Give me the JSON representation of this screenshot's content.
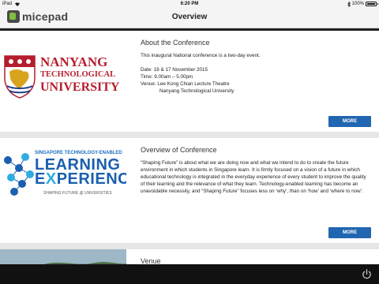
{
  "status_bar": {
    "device": "iPad",
    "time": "6:20 PM",
    "battery": "100%"
  },
  "header": {
    "logo_text": "micepad",
    "title": "Overview"
  },
  "cards": [
    {
      "image_label": "Nanyang Technological University logo",
      "title": "About the Conference",
      "intro": "This inaugural National conference is a two-day event.",
      "date": "Date: 16 & 17 November 2015",
      "time": "Time: 9.00am – 5.00pm",
      "venue": "Venue: Lee Kong Chian Lecture Theatre",
      "venue_2": "Nanyang Technological University",
      "button": "MORE"
    },
    {
      "image_label": "Learning Experience logo",
      "title": "Overview of Conference",
      "body": "“Shaping Future” is about what we are doing now and what we intend to do to create the future environment in which students in Singapore learn. It is firmly focused on a vision of a future in which educational technology is integrated in the everyday experience of every student to improve the quality of their learning and the relevance of what they learn. Technology-enabled learning has become an unavoidable necessity, and “Shaping Future” focuses less on ‘why’, than on ‘how’ and ‘where to now’.",
      "button": "MORE"
    },
    {
      "title": "Venue"
    }
  ],
  "ntu_logo": {
    "line1": "NANYANG",
    "line2": "TECHNOLOGICAL",
    "line3": "UNIVERSITY"
  },
  "lx_logo": {
    "top": "SINGAPORE TECHNOLOGY-ENABLED",
    "line1": "LEARNING",
    "line2_a": "E",
    "line2_x": "X",
    "line2_b": "PERIENCE",
    "bottom": "SHAPING FUTURE @ UNIVERSITIES"
  },
  "colors": {
    "accent": "#2166b0",
    "ntu_red": "#b41e2e",
    "bar_dark": "#111111"
  },
  "icons": [
    "wifi-icon",
    "bluetooth-icon",
    "battery-icon",
    "power-icon"
  ]
}
